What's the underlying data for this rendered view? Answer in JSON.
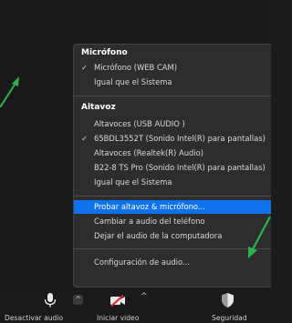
{
  "menu": {
    "microphone_section": {
      "title": "Micrófono",
      "items": [
        {
          "label": "Micrófono (WEB CAM)",
          "checked": true
        },
        {
          "label": "Igual que el Sistema",
          "checked": false
        }
      ]
    },
    "speaker_section": {
      "title": "Altavoz",
      "items": [
        {
          "label": "Altavoces (USB  AUDIO  )",
          "checked": false
        },
        {
          "label": "65BDL3552T (Sonido Intel(R) para pantallas)",
          "checked": true
        },
        {
          "label": "Altavoces (Realtek(R) Audio)",
          "checked": false
        },
        {
          "label": "B22-8 TS Pro (Sonido Intel(R) para pantallas)",
          "checked": false
        },
        {
          "label": "Igual que el Sistema",
          "checked": false
        }
      ]
    },
    "actions": [
      {
        "label": "Probar altavoz & micrófono...",
        "highlighted": true
      },
      {
        "label": "Cambiar a audio del teléfono",
        "highlighted": false
      },
      {
        "label": "Dejar el audio de la computadora",
        "highlighted": false
      }
    ],
    "settings_label": "Configuración de audio...",
    "check_glyph": "✓"
  },
  "toolbar": {
    "mute_label": "Desactivar audio",
    "mute_icon": "microphone-icon",
    "video_label": "Iniciar video",
    "video_icon": "video-off-icon",
    "security_label": "Seguridad",
    "security_icon": "shield-icon",
    "caret_glyph": "^"
  },
  "colors": {
    "highlight": "#0e72ed",
    "menu_bg": "#2d2d2d",
    "arrow": "#2bb24c",
    "video_off": "#e02828"
  }
}
